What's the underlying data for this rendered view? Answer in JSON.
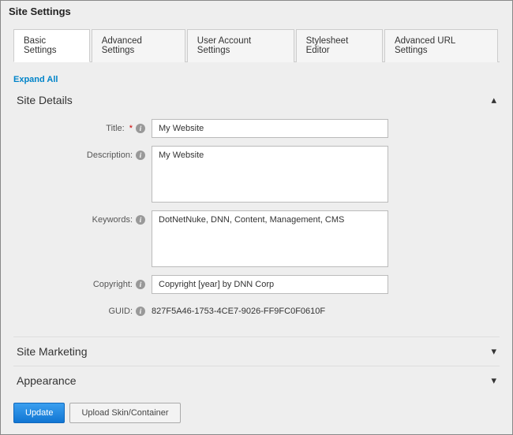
{
  "page_title": "Site Settings",
  "tabs": [
    {
      "label": "Basic Settings",
      "active": true
    },
    {
      "label": "Advanced Settings",
      "active": false
    },
    {
      "label": "User Account Settings",
      "active": false
    },
    {
      "label": "Stylesheet Editor",
      "active": false
    },
    {
      "label": "Advanced URL Settings",
      "active": false
    }
  ],
  "expand_all_label": "Expand All",
  "sections": {
    "details": {
      "title": "Site Details",
      "expanded": true,
      "fields": {
        "title": {
          "label": "Title:",
          "value": "My Website",
          "required": true
        },
        "description": {
          "label": "Description:",
          "value": "My Website"
        },
        "keywords": {
          "label": "Keywords:",
          "value": "DotNetNuke, DNN, Content, Management, CMS"
        },
        "copyright": {
          "label": "Copyright:",
          "value": "Copyright [year] by DNN Corp"
        },
        "guid": {
          "label": "GUID:",
          "value": "827F5A46-1753-4CE7-9026-FF9FC0F0610F"
        }
      }
    },
    "marketing": {
      "title": "Site Marketing",
      "expanded": false
    },
    "appearance": {
      "title": "Appearance",
      "expanded": false
    }
  },
  "buttons": {
    "update": "Update",
    "upload_skin": "Upload Skin/Container"
  },
  "icons": {
    "info_glyph": "i",
    "chevron_up": "▴",
    "chevron_down": "▾"
  }
}
